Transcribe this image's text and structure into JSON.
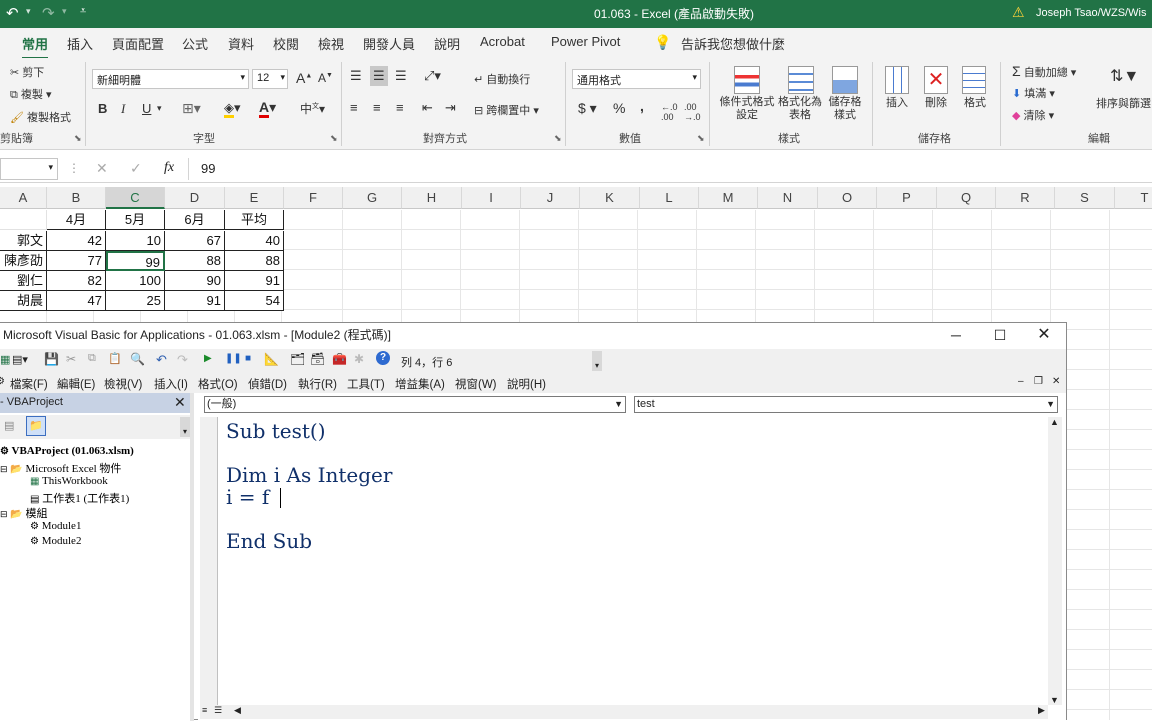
{
  "excel": {
    "title": "01.063 - Excel (產品啟動失敗)",
    "user": "Joseph Tsao/WZS/Wis"
  },
  "tabs": [
    "常用",
    "插入",
    "頁面配置",
    "公式",
    "資料",
    "校閱",
    "檢視",
    "開發人員",
    "說明",
    "Acrobat",
    "Power Pivot"
  ],
  "tell_me": "告訴我您想做什麼",
  "ribbon": {
    "clipboard": {
      "cut": "剪下",
      "copy": "複製",
      "format_painter": "複製格式",
      "label": "剪貼簿"
    },
    "font": {
      "name": "新細明體",
      "size": "12",
      "bold": "B",
      "italic": "I",
      "underline": "U",
      "label": "字型"
    },
    "align": {
      "wrap": "自動換行",
      "merge": "跨欄置中",
      "label": "對齊方式"
    },
    "number": {
      "format": "通用格式",
      "currency": "$",
      "percent": "%",
      "comma": ",",
      "label": "數值"
    },
    "styles": {
      "cond": "條件式格式設定",
      "table": "格式化為表格",
      "cell": "儲存格樣式",
      "label": "樣式"
    },
    "cells": {
      "insert": "插入",
      "delete": "刪除",
      "format": "格式",
      "label": "儲存格"
    },
    "editing": {
      "autosum": "自動加總",
      "fill": "填滿",
      "clear": "清除",
      "sort": "排序與篩選",
      "label": "編輯"
    }
  },
  "formula": {
    "namebox": "",
    "value": "99"
  },
  "sheet": {
    "columns": [
      "A",
      "B",
      "C",
      "D",
      "E",
      "F",
      "G",
      "H",
      "I",
      "J",
      "K",
      "L",
      "M",
      "N",
      "O",
      "P",
      "Q",
      "R",
      "S",
      "T"
    ],
    "header": [
      "",
      "4月",
      "5月",
      "6月",
      "平均"
    ],
    "rows": [
      [
        "郭文",
        "42",
        "10",
        "67",
        "40"
      ],
      [
        "陳彥劭",
        "77",
        "99",
        "88",
        "88"
      ],
      [
        "劉仁",
        "82",
        "100",
        "90",
        "91"
      ],
      [
        "胡晨",
        "47",
        "25",
        "91",
        "54"
      ]
    ]
  },
  "vba": {
    "title": "Microsoft Visual Basic for Applications - 01.063.xlsm - [Module2 (程式碼)]",
    "position": "列 4，行 6",
    "menu": [
      "檔案(F)",
      "編輯(E)",
      "檢視(V)",
      "插入(I)",
      "格式(O)",
      "偵錯(D)",
      "執行(R)",
      "工具(T)",
      "增益集(A)",
      "視窗(W)",
      "說明(H)"
    ],
    "project_title": "- VBAProject",
    "tree": [
      "VBAProject (01.063.xlsm)",
      "Microsoft Excel 物件",
      "ThisWorkbook",
      "工作表1 (工作表1)",
      "模組",
      "Module1",
      "Module2"
    ],
    "object_combo": "(一般)",
    "proc_combo": "test",
    "code": [
      "Sub test()",
      "",
      "Dim i As Integer",
      "i = f",
      "",
      "End Sub"
    ]
  }
}
